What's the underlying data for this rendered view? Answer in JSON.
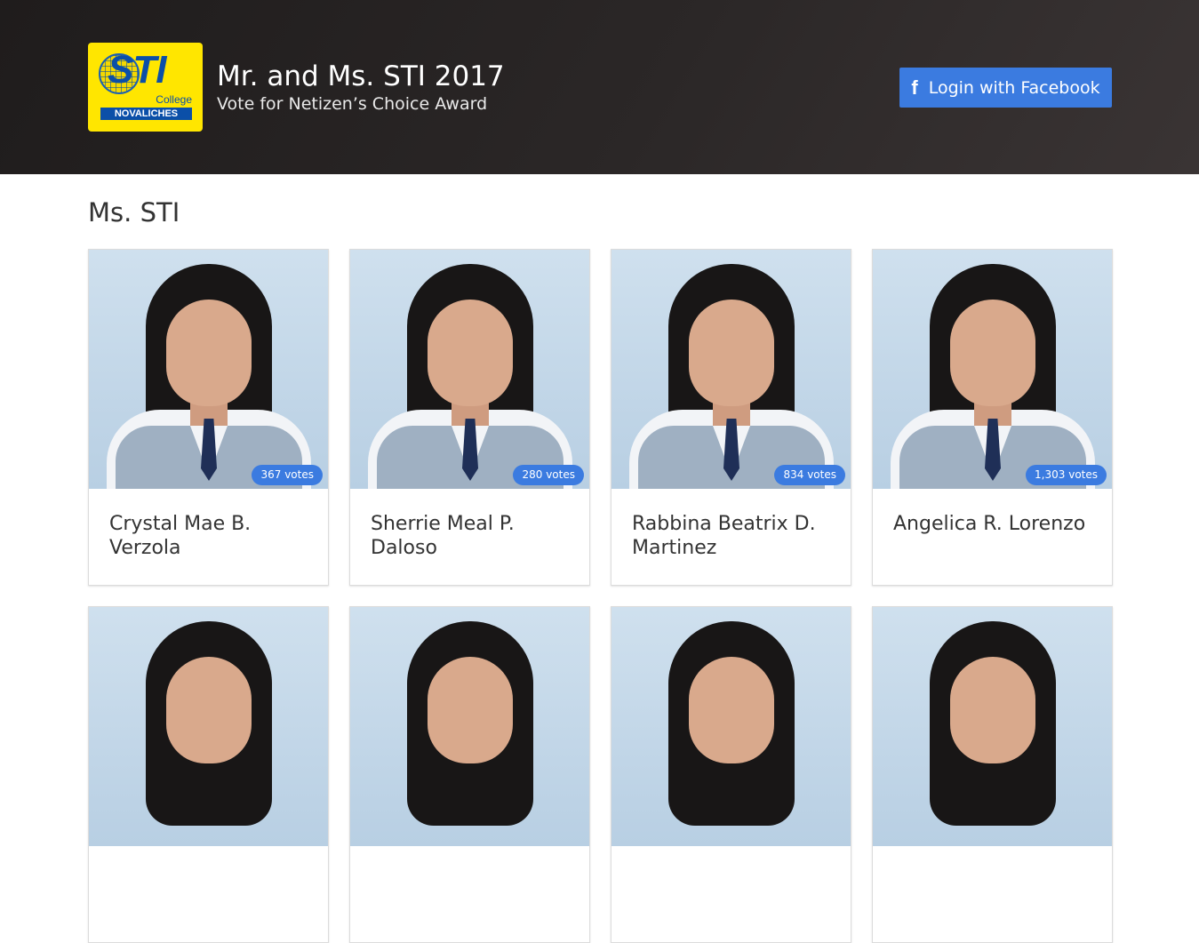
{
  "header": {
    "logo": {
      "brand": "STI",
      "college": "College",
      "campus": "NOVALICHES"
    },
    "title": "Mr. and Ms. STI 2017",
    "subtitle": "Vote for Netizen’s Choice Award",
    "login_button": "Login with Facebook",
    "login_icon": "facebook-f-icon"
  },
  "section": {
    "title": "Ms. STI"
  },
  "candidates": [
    {
      "name": "Crystal Mae B. Verzola",
      "votes": "367 votes"
    },
    {
      "name": "Sherrie Meal P. Daloso",
      "votes": "280 votes"
    },
    {
      "name": "Rabbina Beatrix D. Martinez",
      "votes": "834 votes"
    },
    {
      "name": "Angelica R. Lorenzo",
      "votes": "1,303 votes"
    },
    {
      "name": "",
      "votes": ""
    },
    {
      "name": "",
      "votes": ""
    },
    {
      "name": "",
      "votes": ""
    },
    {
      "name": "",
      "votes": ""
    }
  ],
  "colors": {
    "header_bg": "#2b2727",
    "accent": "#3b7be0",
    "logo_bg": "#ffe600",
    "logo_blue": "#0b4fa8"
  }
}
